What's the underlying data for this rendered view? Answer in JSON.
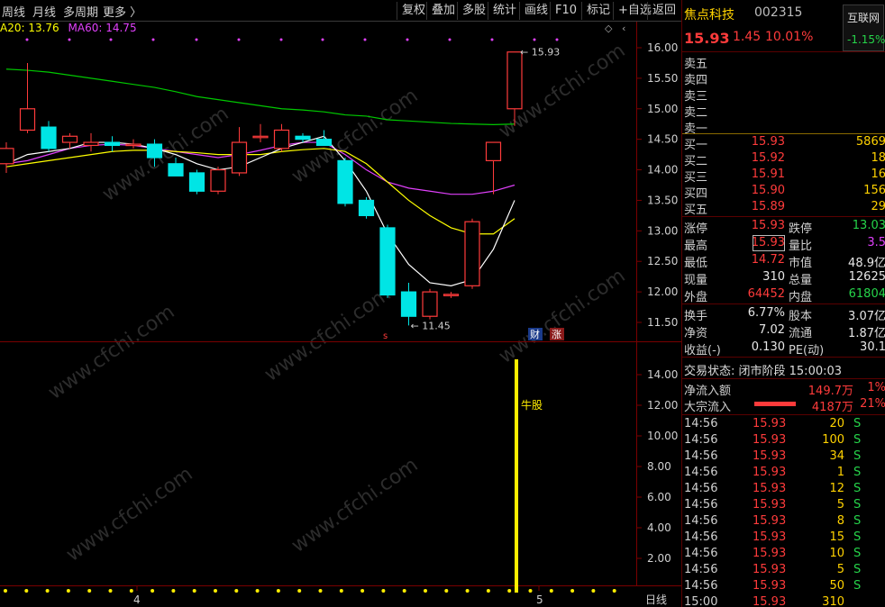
{
  "toolbar": {
    "left_items": [
      "周线",
      "月线",
      "多周期",
      "更多 〉"
    ],
    "right_buttons": [
      "复权",
      "叠加",
      "多股",
      "统计",
      "画线",
      "F10",
      "标记",
      "+自选",
      "返回"
    ]
  },
  "ma_legend": {
    "ma20": "A20: 13.76",
    "ma60": "MA60: 14.75"
  },
  "main_chart": {
    "y_ticks": [
      "16.00",
      "15.50",
      "15.00",
      "14.50",
      "14.00",
      "13.50",
      "13.00",
      "12.50",
      "12.00",
      "11.50"
    ],
    "high_marker": "15.93",
    "low_marker": "11.45",
    "event_tags": [
      "财",
      "涨"
    ]
  },
  "indicator_chart": {
    "y_ticks": [
      "14.00",
      "12.00",
      "10.00",
      "8.00",
      "6.00",
      "4.00",
      "2.00"
    ],
    "signal_label": "牛股"
  },
  "x_axis": {
    "labels": [
      "4",
      "5"
    ],
    "period": "日线"
  },
  "watermark": "www.cfchi.com",
  "stock": {
    "name": "焦点科技",
    "code": "002315",
    "price": "15.93",
    "change": "1.45",
    "change_pct": "10.01%",
    "tab_label": "互联网",
    "tab_change": "-1.15%"
  },
  "order_book": {
    "sell": [
      {
        "label": "卖五"
      },
      {
        "label": "卖四"
      },
      {
        "label": "卖三"
      },
      {
        "label": "卖二"
      },
      {
        "label": "卖一"
      }
    ],
    "buy": [
      {
        "label": "买一",
        "price": "15.93",
        "vol": "5869"
      },
      {
        "label": "买二",
        "price": "15.92",
        "vol": "18"
      },
      {
        "label": "买三",
        "price": "15.91",
        "vol": "16"
      },
      {
        "label": "买四",
        "price": "15.90",
        "vol": "156"
      },
      {
        "label": "买五",
        "price": "15.89",
        "vol": "29"
      }
    ]
  },
  "quote_stats": [
    {
      "l1": "涨停",
      "v1": "15.93",
      "l2": "跌停",
      "v2": "13.03"
    },
    {
      "l1": "最高",
      "v1": "15.93",
      "l2": "量比",
      "v2": "3.5"
    },
    {
      "l1": "最低",
      "v1": "14.72",
      "l2": "市值",
      "v2": "48.9亿"
    },
    {
      "l1": "现量",
      "v1": "310",
      "l2": "总量",
      "v2": "12625"
    },
    {
      "l1": "外盘",
      "v1": "64452",
      "l2": "内盘",
      "v2": "61804"
    }
  ],
  "fundamentals": [
    {
      "l1": "换手",
      "v1": "6.77%",
      "l2": "股本",
      "v2": "3.07亿"
    },
    {
      "l1": "净资",
      "v1": "7.02",
      "l2": "流通",
      "v2": "1.87亿"
    },
    {
      "l1": "收益(-)",
      "v1": "0.130",
      "l2": "PE(动)",
      "v2": "30.1"
    }
  ],
  "trade_status": "交易状态: 闭市阶段 15:00:03",
  "fund_flow": [
    {
      "label": "净流入额",
      "value": "149.7万",
      "extra": "1%"
    },
    {
      "label": "大宗流入",
      "value": "4187万",
      "extra": "21%"
    }
  ],
  "ticks": [
    {
      "time": "14:56",
      "price": "15.93",
      "vol": "20",
      "dir": "S"
    },
    {
      "time": "14:56",
      "price": "15.93",
      "vol": "100",
      "dir": "S"
    },
    {
      "time": "14:56",
      "price": "15.93",
      "vol": "34",
      "dir": "S"
    },
    {
      "time": "14:56",
      "price": "15.93",
      "vol": "1",
      "dir": "S"
    },
    {
      "time": "14:56",
      "price": "15.93",
      "vol": "12",
      "dir": "S"
    },
    {
      "time": "14:56",
      "price": "15.93",
      "vol": "5",
      "dir": "S"
    },
    {
      "time": "14:56",
      "price": "15.93",
      "vol": "8",
      "dir": "S"
    },
    {
      "time": "14:56",
      "price": "15.93",
      "vol": "15",
      "dir": "S"
    },
    {
      "time": "14:56",
      "price": "15.93",
      "vol": "10",
      "dir": "S"
    },
    {
      "time": "14:56",
      "price": "15.93",
      "vol": "5",
      "dir": "S"
    },
    {
      "time": "14:56",
      "price": "15.93",
      "vol": "50",
      "dir": "S"
    },
    {
      "time": "15:00",
      "price": "15.93",
      "vol": "310",
      "dir": ""
    }
  ],
  "colors": {
    "up": "#ff3b3b",
    "down": "#00e5e5",
    "ma_short": "#ffffff",
    "ma20": "#ffff00",
    "ma60": "#e040fb",
    "ma_long": "#00c800",
    "signal": "#ffee00"
  },
  "chart_data": {
    "type": "candlestick",
    "y_range": [
      11.2,
      16.3
    ],
    "candles": [
      {
        "o": 14.1,
        "h": 14.45,
        "l": 13.95,
        "c": 14.35
      },
      {
        "o": 14.65,
        "h": 15.75,
        "l": 14.6,
        "c": 15.0
      },
      {
        "o": 14.7,
        "h": 14.8,
        "l": 14.3,
        "c": 14.35
      },
      {
        "o": 14.45,
        "h": 14.6,
        "l": 14.35,
        "c": 14.55
      },
      {
        "o": 14.4,
        "h": 14.6,
        "l": 14.3,
        "c": 14.45
      },
      {
        "o": 14.45,
        "h": 14.55,
        "l": 14.3,
        "c": 14.4
      },
      {
        "o": 14.4,
        "h": 14.5,
        "l": 14.35,
        "c": 14.42
      },
      {
        "o": 14.42,
        "h": 14.5,
        "l": 14.05,
        "c": 14.2
      },
      {
        "o": 14.1,
        "h": 14.2,
        "l": 13.95,
        "c": 13.9
      },
      {
        "o": 13.95,
        "h": 14.0,
        "l": 13.6,
        "c": 13.65
      },
      {
        "o": 13.65,
        "h": 14.05,
        "l": 13.6,
        "c": 14.0
      },
      {
        "o": 13.95,
        "h": 14.7,
        "l": 13.9,
        "c": 14.45
      },
      {
        "o": 14.55,
        "h": 14.75,
        "l": 14.45,
        "c": 14.55
      },
      {
        "o": 14.35,
        "h": 14.75,
        "l": 14.3,
        "c": 14.65
      },
      {
        "o": 14.55,
        "h": 14.6,
        "l": 14.45,
        "c": 14.5
      },
      {
        "o": 14.5,
        "h": 14.65,
        "l": 14.4,
        "c": 14.4
      },
      {
        "o": 14.15,
        "h": 14.2,
        "l": 13.4,
        "c": 13.45
      },
      {
        "o": 13.5,
        "h": 13.55,
        "l": 13.2,
        "c": 13.25
      },
      {
        "o": 13.05,
        "h": 13.1,
        "l": 11.9,
        "c": 11.95
      },
      {
        "o": 12.0,
        "h": 12.15,
        "l": 11.45,
        "c": 11.6
      },
      {
        "o": 11.6,
        "h": 12.05,
        "l": 11.55,
        "c": 12.0
      },
      {
        "o": 11.95,
        "h": 12.0,
        "l": 11.9,
        "c": 11.96
      },
      {
        "o": 12.1,
        "h": 13.2,
        "l": 12.05,
        "c": 13.15
      },
      {
        "o": 14.15,
        "h": 14.45,
        "l": 13.6,
        "c": 14.45
      },
      {
        "o": 15.0,
        "h": 15.93,
        "l": 14.72,
        "c": 15.93
      }
    ],
    "ma_short": [
      14.1,
      14.25,
      14.3,
      14.35,
      14.45,
      14.45,
      14.42,
      14.35,
      14.25,
      14.1,
      14.0,
      14.05,
      14.2,
      14.35,
      14.45,
      14.55,
      14.15,
      13.65,
      12.95,
      12.45,
      12.15,
      12.1,
      12.2,
      12.7,
      13.5
    ],
    "ma20": [
      14.05,
      14.1,
      14.15,
      14.2,
      14.25,
      14.3,
      14.32,
      14.32,
      14.3,
      14.28,
      14.25,
      14.25,
      14.25,
      14.3,
      14.33,
      14.35,
      14.3,
      14.1,
      13.8,
      13.5,
      13.25,
      13.05,
      12.95,
      12.95,
      13.2
    ],
    "ma60_mid": [
      14.1,
      14.15,
      14.25,
      14.35,
      14.4,
      14.42,
      14.4,
      14.35,
      14.3,
      14.25,
      14.2,
      14.25,
      14.32,
      14.4,
      14.45,
      14.45,
      14.25,
      14.0,
      13.8,
      13.7,
      13.65,
      13.6,
      13.6,
      13.65,
      13.75
    ],
    "ma_long": [
      15.65,
      15.63,
      15.6,
      15.55,
      15.5,
      15.45,
      15.4,
      15.35,
      15.28,
      15.2,
      15.15,
      15.1,
      15.05,
      15.0,
      14.98,
      14.95,
      14.9,
      14.88,
      14.82,
      14.8,
      14.78,
      14.76,
      14.75,
      14.74,
      14.75
    ]
  }
}
